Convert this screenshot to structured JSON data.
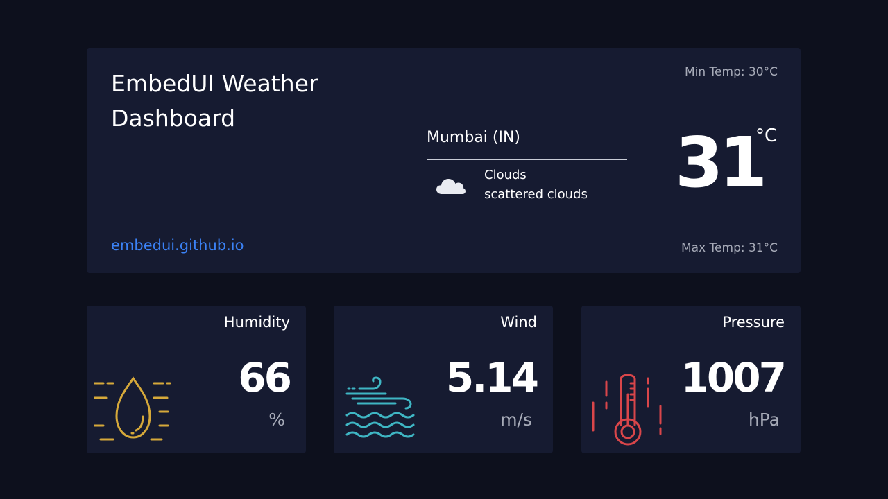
{
  "header": {
    "title": "EmbedUI Weather Dashboard",
    "link_text": "embedui.github.io"
  },
  "weather": {
    "min_temp": "Min Temp: 30°C",
    "max_temp": "Max Temp: 31°C",
    "city": "Mumbai (IN)",
    "condition": "Clouds",
    "description": "scattered clouds",
    "temp": "31",
    "temp_unit": "°C",
    "condition_icon": "cloud-icon"
  },
  "stats": [
    {
      "label": "Humidity",
      "value": "66",
      "unit": "%",
      "icon": "droplet-icon",
      "color": "#d6a93a"
    },
    {
      "label": "Wind",
      "value": "5.14",
      "unit": "m/s",
      "icon": "wind-icon",
      "color": "#3fb6c4"
    },
    {
      "label": "Pressure",
      "value": "1007",
      "unit": "hPa",
      "icon": "thermometer-icon",
      "color": "#d9464a"
    }
  ],
  "colors": {
    "background": "#0d101d",
    "card": "#161b31",
    "link": "#3b82f6",
    "muted_text": "#a7abb8"
  }
}
